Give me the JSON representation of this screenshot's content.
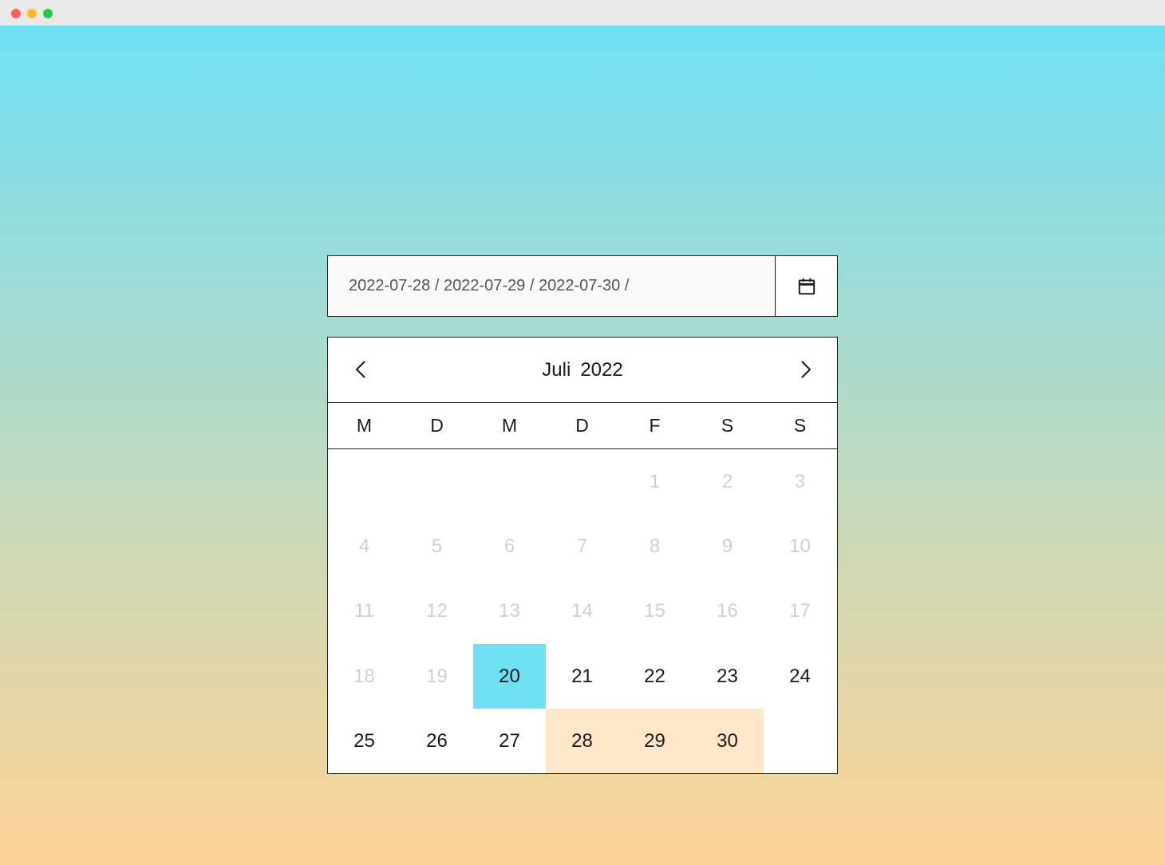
{
  "date_field": {
    "value": "2022-07-28 / 2022-07-29 / 2022-07-30 /",
    "icon": "calendar-icon"
  },
  "calendar": {
    "month": "Juli",
    "year": "2022",
    "prev_icon": "chevron-left-icon",
    "next_icon": "chevron-right-icon",
    "weekdays": [
      "M",
      "D",
      "M",
      "D",
      "F",
      "S",
      "S"
    ],
    "first_weekday_index": 4,
    "days": [
      {
        "label": "1",
        "state": "disabled"
      },
      {
        "label": "2",
        "state": "disabled"
      },
      {
        "label": "3",
        "state": "disabled"
      },
      {
        "label": "4",
        "state": "disabled"
      },
      {
        "label": "5",
        "state": "disabled"
      },
      {
        "label": "6",
        "state": "disabled"
      },
      {
        "label": "7",
        "state": "disabled"
      },
      {
        "label": "8",
        "state": "disabled"
      },
      {
        "label": "9",
        "state": "disabled"
      },
      {
        "label": "10",
        "state": "disabled"
      },
      {
        "label": "11",
        "state": "disabled"
      },
      {
        "label": "12",
        "state": "disabled"
      },
      {
        "label": "13",
        "state": "disabled"
      },
      {
        "label": "14",
        "state": "disabled"
      },
      {
        "label": "15",
        "state": "disabled"
      },
      {
        "label": "16",
        "state": "disabled"
      },
      {
        "label": "17",
        "state": "disabled"
      },
      {
        "label": "18",
        "state": "disabled"
      },
      {
        "label": "19",
        "state": "disabled"
      },
      {
        "label": "20",
        "state": "today"
      },
      {
        "label": "21",
        "state": "normal"
      },
      {
        "label": "22",
        "state": "normal"
      },
      {
        "label": "23",
        "state": "normal"
      },
      {
        "label": "24",
        "state": "normal"
      },
      {
        "label": "25",
        "state": "normal"
      },
      {
        "label": "26",
        "state": "normal"
      },
      {
        "label": "27",
        "state": "normal"
      },
      {
        "label": "28",
        "state": "selected"
      },
      {
        "label": "29",
        "state": "selected"
      },
      {
        "label": "30",
        "state": "selected"
      }
    ]
  },
  "colors": {
    "today_bg": "#70e0f4",
    "selected_bg": "#ffe6c8",
    "disabled_text": "#cfcfcf",
    "gradient_top": "#6fe0f4",
    "gradient_bottom": "#fdd295"
  }
}
